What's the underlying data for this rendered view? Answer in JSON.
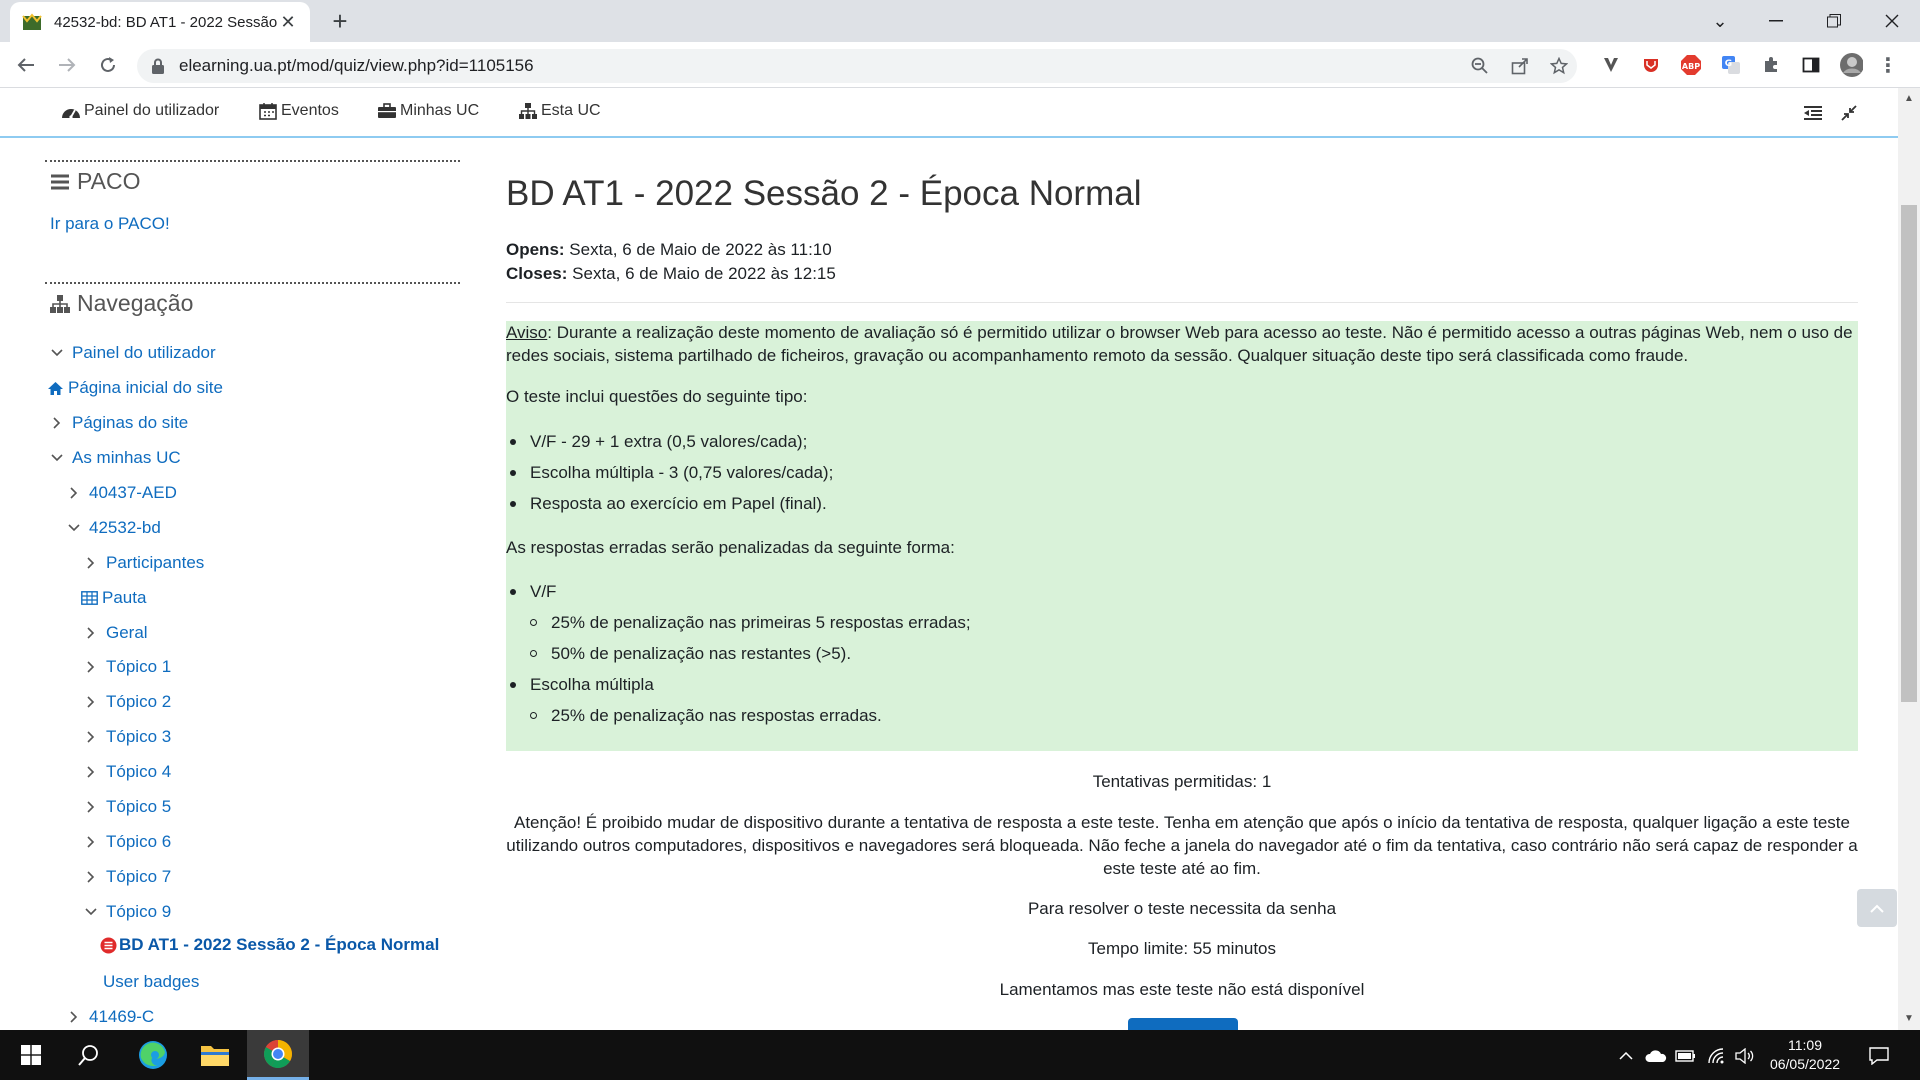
{
  "browser": {
    "tab_title": "42532-bd: BD AT1 - 2022 Sessão",
    "url": "elearning.ua.pt/mod/quiz/view.php?id=1105156",
    "extension_abp_label": "ABP"
  },
  "navbar": {
    "items": [
      {
        "label": "Painel do utilizador",
        "icon": "dashboard-icon"
      },
      {
        "label": "Eventos",
        "icon": "calendar-icon"
      },
      {
        "label": "Minhas UC",
        "icon": "briefcase-icon"
      },
      {
        "label": "Esta UC",
        "icon": "sitemap-icon"
      }
    ]
  },
  "sidebar": {
    "paco_title": "PACO",
    "paco_link": "Ir para o PACO!",
    "nav_title": "Navegação",
    "tree": [
      {
        "label": "Painel do utilizador"
      },
      {
        "label": "Página inicial do site"
      },
      {
        "label": "Páginas do site"
      },
      {
        "label": "As minhas UC"
      },
      {
        "label": "40437-AED"
      },
      {
        "label": "42532-bd"
      },
      {
        "label": "Participantes"
      },
      {
        "label": "Pauta"
      },
      {
        "label": "Geral"
      },
      {
        "label": "Tópico 1"
      },
      {
        "label": "Tópico 2"
      },
      {
        "label": "Tópico 3"
      },
      {
        "label": "Tópico 4"
      },
      {
        "label": "Tópico 5"
      },
      {
        "label": "Tópico 6"
      },
      {
        "label": "Tópico 7"
      },
      {
        "label": "Tópico 9"
      },
      {
        "label": "BD AT1 - 2022 Sessão 2 - Época Normal"
      },
      {
        "label": "User badges"
      },
      {
        "label": "41469-C"
      }
    ]
  },
  "main": {
    "title": "BD AT1 - 2022 Sessão 2 - Época Normal",
    "opens_label": "Opens:",
    "opens_value": " Sexta, 6 de Maio de 2022 às 11:10",
    "closes_label": "Closes:",
    "closes_value": " Sexta, 6 de Maio de 2022 às 12:15",
    "notice": {
      "aviso_label": "Aviso",
      "aviso_text": ": Durante a realização deste momento de avaliação só é permitido utilizar o browser Web para acesso ao teste. Não é permitido acesso a outras páginas Web, nem o uso de redes sociais, sistema partilhado de ficheiros, gravação ou acompanhamento remoto da sessão. Qualquer situação deste tipo será classificada como fraude.",
      "types_intro": "O teste inclui questões do seguinte tipo:",
      "types": [
        "V/F -  29 + 1 extra (0,5 valores/cada);",
        "Escolha múltipla - 3 (0,75 valores/cada);",
        "Resposta ao exercício em Papel (final)."
      ],
      "penalty_intro": "As respostas erradas serão penalizadas da seguinte forma:",
      "penalty_vf": "V/F",
      "penalty_vf_items": [
        "25% de penalização nas primeiras 5 respostas erradas;",
        "50% de penalização nas restantes (>5)."
      ],
      "penalty_mc": "Escolha múltipla",
      "penalty_mc_items": [
        "25% de penalização nas respostas erradas."
      ]
    },
    "attempts": "Tentativas permitidas: 1",
    "warning": "Atenção! É proibido mudar de dispositivo durante a tentativa de resposta a este teste. Tenha em atenção que após o início da tentativa de resposta, qualquer ligação a este teste utilizando outros computadores, dispositivos e navegadores será bloqueada. Não feche a janela do navegador até o fim da tentativa, caso contrário não será capaz de responder a este teste até ao fim.",
    "password": "Para resolver o teste necessita da senha",
    "time_limit": "Tempo limite: 55 minutos",
    "unavailable": "Lamentamos mas este teste não está disponível"
  },
  "taskbar": {
    "time": "11:09",
    "date": "06/05/2022"
  },
  "colors": {
    "link": "#0f6cbf",
    "notice_bg": "#d9f2d9",
    "nav_border": "#8ecbf1",
    "taskbar": "#101010"
  }
}
